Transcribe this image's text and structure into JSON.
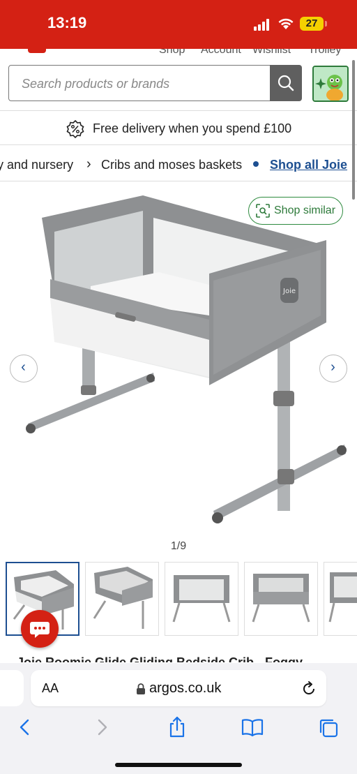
{
  "status_bar": {
    "time": "13:19",
    "battery": "27"
  },
  "top_nav": {
    "items": [
      "Shop",
      "Account",
      "Wishlist",
      "Trolley"
    ]
  },
  "search": {
    "placeholder": "Search products or brands"
  },
  "delivery_banner": {
    "text": "Free delivery when you spend £100"
  },
  "breadcrumb": {
    "items": [
      "Baby and nursery",
      "Cribs and moses baskets"
    ],
    "shop_all": "Shop all Joie"
  },
  "gallery": {
    "shop_similar": "Shop similar",
    "counter": "1/9",
    "brand_label": "Joie"
  },
  "product": {
    "title": "Joie Roomie Glide Gliding Bedside Crib - Foggy"
  },
  "browser": {
    "aa_label": "AA",
    "url": "argos.co.uk"
  },
  "colors": {
    "brand_red": "#d42114",
    "link_blue": "#1d4f91",
    "similar_green": "#2d7a3a"
  }
}
